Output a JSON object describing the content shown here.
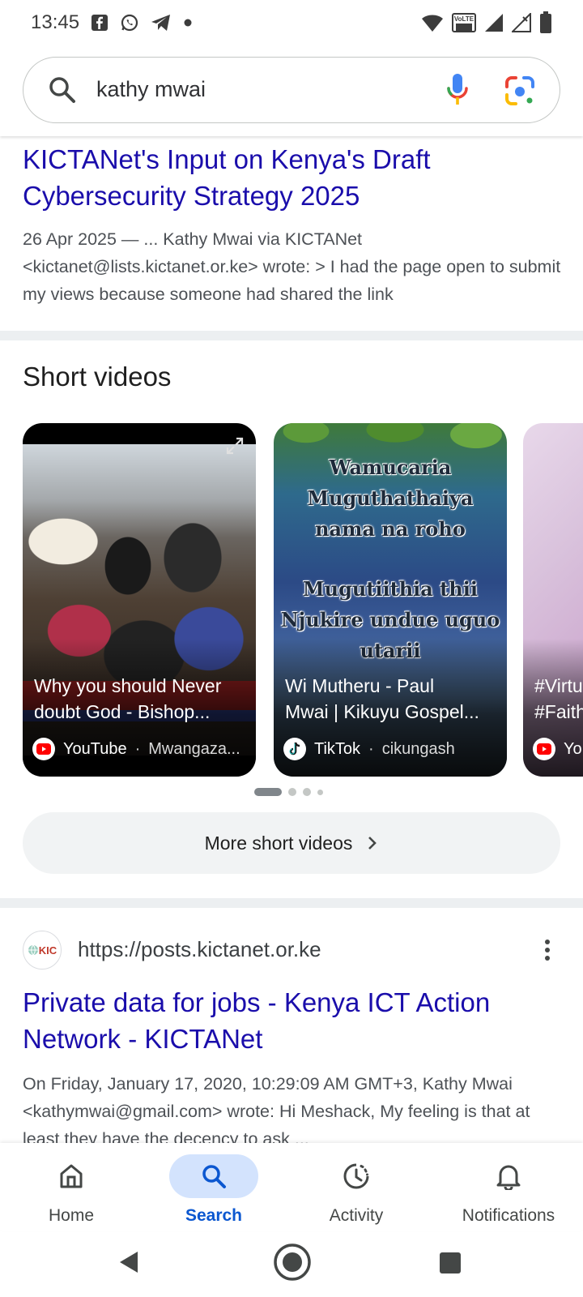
{
  "status_bar": {
    "time": "13:45",
    "left_icons": [
      "facebook-icon",
      "whatsapp-icon",
      "telegram-icon",
      "dot-icon"
    ],
    "right_icons": [
      "wifi-icon",
      "volte-icon",
      "signal-icon",
      "signal-x-icon",
      "battery-icon"
    ],
    "volte_label": "VoLTE"
  },
  "search": {
    "query": "kathy mwai"
  },
  "result1": {
    "title": "KICTANet's Input on Kenya's Draft Cybersecurity Strategy 2025",
    "snippet": "26 Apr 2025 — ... Kathy Mwai via KICTANet <kictanet@lists.kictanet.or.ke> wrote: > I had the page open to submit my views because someone had shared the link"
  },
  "short_videos": {
    "heading": "Short videos",
    "cards": [
      {
        "caption_line1": "Why you should Never",
        "caption_line2": "doubt God - Bishop...",
        "source": "YouTube",
        "channel": "Mwangaza...",
        "overlay": [],
        "partial": false
      },
      {
        "caption_line1": "Wi Mutheru - Paul",
        "caption_line2": "Mwai | Kikuyu Gospel...",
        "source": "TikTok",
        "channel": "cikungash",
        "overlay": [
          "Wamucaria",
          "Muguthathaiya",
          "nama na roho",
          "Mugutiithia thii",
          "Njukire undue uguo",
          "utarii"
        ],
        "partial": false
      },
      {
        "caption_line1": "#Virtu",
        "caption_line2": "#Faith",
        "source": "Yo",
        "channel": "",
        "overlay": [],
        "partial": true
      }
    ],
    "more_label": "More short videos"
  },
  "result2": {
    "favicon_text": "KIC",
    "url": "https://posts.kictanet.or.ke",
    "title": "Private data for jobs - Kenya ICT Action Network - KICTANet",
    "snippet": "On Friday, January 17, 2020, 10:29:09 AM GMT+3, Kathy Mwai <kathymwai@gmail.com> wrote: Hi Meshack, My feeling is that at least they have the decency to ask ..."
  },
  "bottom_nav": {
    "items": [
      {
        "label": "Home",
        "icon": "home-icon",
        "active": false
      },
      {
        "label": "Search",
        "icon": "search-icon",
        "active": true
      },
      {
        "label": "Activity",
        "icon": "activity-icon",
        "active": false
      },
      {
        "label": "Notifications",
        "icon": "bell-icon",
        "active": false
      }
    ]
  },
  "colors": {
    "link": "#1a0dab",
    "active_nav": "#0b57d0",
    "active_pill": "#d3e3fd"
  }
}
